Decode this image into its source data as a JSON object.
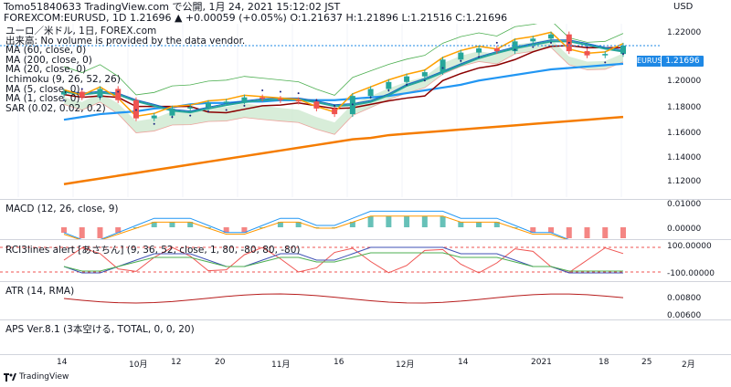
{
  "header": {
    "line1": "Tomo51840633 TradingView.com で公開, 1月 24, 2021 15:12:02 JST",
    "line2": "FOREXCOM:EURUSD, 1D 1.21696 ▲ +0.00059 (+0.05%) O:1.21637 H:1.21896 L:1.21516 C:1.21696",
    "currency": "USD"
  },
  "main_pane": {
    "legend": [
      "ユーロ／米ドル, 1日, FOREX.com",
      "出来高: No volume is provided by the data vendor.",
      "MA (60, close, 0)",
      "MA (200, close, 0)",
      "MA (20, close, 0)",
      "Ichimoku (9, 26, 52, 26)",
      "MA (5, close, 0)",
      "MA (1, close, 0)",
      "SAR (0.02, 0.02, 0.2)"
    ],
    "price_tag_name": "EURUSD",
    "price_tag_value": "1.21696",
    "y_ticks": [
      "1.22000",
      "1.20000",
      "1.18000",
      "1.16000",
      "1.14000",
      "1.12000"
    ]
  },
  "macd_pane": {
    "legend": "MACD (12, 26, close, 9)",
    "y_ticks": [
      "0.01000",
      "0.00000"
    ]
  },
  "rci_pane": {
    "legend": "RCI3lines alert [あさちん] (9, 36, 52, close, 1, 80, -80, 80, -80)",
    "y_ticks": [
      "100.00000",
      "-100.00000"
    ]
  },
  "atr_pane": {
    "legend": "ATR (14, RMA)",
    "y_ticks": [
      "0.00800",
      "0.00600"
    ]
  },
  "aps_pane": {
    "legend": "APS Ver.8.1 (3本空ける, TOTAL, 0, 0, 20)"
  },
  "x_axis": {
    "labels": [
      "14",
      "10月",
      "12",
      "20",
      "11月",
      "16",
      "12月",
      "14",
      "2021",
      "18",
      "25",
      "2月"
    ]
  },
  "footer": {
    "brand": "TradingView"
  },
  "colors": {
    "ma60": "#2196f3",
    "ma200": "#f57c00",
    "ma20": "#26a69a",
    "ma5": "#ffa000",
    "kijun": "#8b0000",
    "tenkan": "#1565c0",
    "span": "#4caf50",
    "cloud": "#c8e6c9",
    "cloud_red": "#ffcdd2",
    "up": "#26a69a",
    "down": "#ef5350"
  },
  "chart_data": [
    {
      "type": "line",
      "title": "ユーロ／米ドル, 1日, FOREX.com",
      "ylim": [
        1.11,
        1.23
      ],
      "series": [
        {
          "name": "MA (1, close, 0)",
          "values": [
            1.184,
            1.18,
            1.186,
            1.178,
            1.165,
            1.167,
            1.172,
            1.173,
            1.176,
            1.177,
            1.18,
            1.179,
            1.178,
            1.177,
            1.172,
            1.168,
            1.181,
            1.186,
            1.191,
            1.195,
            1.198,
            1.207,
            1.212,
            1.215,
            1.213,
            1.22,
            1.222,
            1.225,
            1.213,
            1.21,
            1.211,
            1.217
          ]
        },
        {
          "name": "MA (60, close, 0)",
          "values": [
            1.164,
            1.166,
            1.168,
            1.169,
            1.17,
            1.172,
            1.173,
            1.175,
            1.176,
            1.176,
            1.177,
            1.177,
            1.178,
            1.178,
            1.178,
            1.178,
            1.179,
            1.18,
            1.181,
            1.183,
            1.185,
            1.187,
            1.189,
            1.192,
            1.194,
            1.196,
            1.198,
            1.2,
            1.201,
            1.202,
            1.203,
            1.204
          ]
        },
        {
          "name": "MA (200, close, 0)",
          "values": [
            1.118,
            1.12,
            1.122,
            1.124,
            1.126,
            1.128,
            1.13,
            1.132,
            1.134,
            1.136,
            1.138,
            1.14,
            1.142,
            1.144,
            1.146,
            1.148,
            1.15,
            1.151,
            1.153,
            1.154,
            1.155,
            1.156,
            1.157,
            1.158,
            1.159,
            1.16,
            1.161,
            1.162,
            1.163,
            1.164,
            1.165,
            1.166
          ]
        }
      ]
    },
    {
      "type": "bar",
      "title": "MACD (12, 26, close, 9)",
      "values": [
        -0.001,
        -0.002,
        -0.002,
        -0.001,
        0.0,
        0.001,
        0.001,
        0.001,
        0.0,
        -0.001,
        -0.001,
        0.0,
        0.001,
        0.001,
        0.0,
        0.0,
        0.001,
        0.002,
        0.002,
        0.002,
        0.002,
        0.002,
        0.001,
        0.001,
        0.001,
        0.0,
        -0.001,
        -0.001,
        -0.002,
        -0.002,
        -0.002,
        -0.002
      ]
    }
  ]
}
